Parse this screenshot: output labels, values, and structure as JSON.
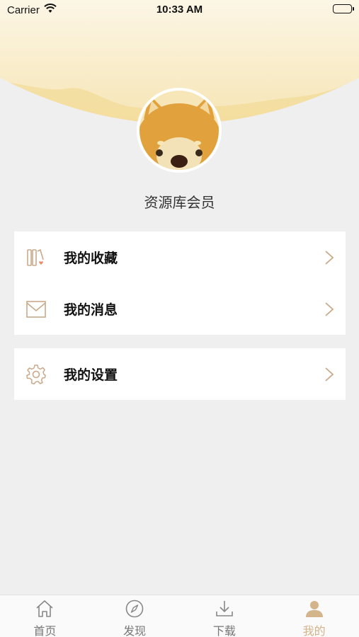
{
  "status_bar": {
    "carrier": "Carrier",
    "time": "10:33 AM"
  },
  "profile": {
    "username": "资源库会员"
  },
  "menu": {
    "items": [
      {
        "label": "我的收藏",
        "icon": "books-heart-icon"
      },
      {
        "label": "我的消息",
        "icon": "envelope-icon"
      },
      {
        "label": "我的设置",
        "icon": "gear-icon"
      }
    ]
  },
  "tabbar": {
    "items": [
      {
        "label": "首页",
        "icon": "home-icon",
        "active": false
      },
      {
        "label": "发现",
        "icon": "compass-icon",
        "active": false
      },
      {
        "label": "下载",
        "icon": "download-icon",
        "active": false
      },
      {
        "label": "我的",
        "icon": "person-icon",
        "active": true
      }
    ]
  },
  "colors": {
    "accent": "#d4b48a",
    "background": "#efefef",
    "header_bg": "#fcf6e6"
  }
}
